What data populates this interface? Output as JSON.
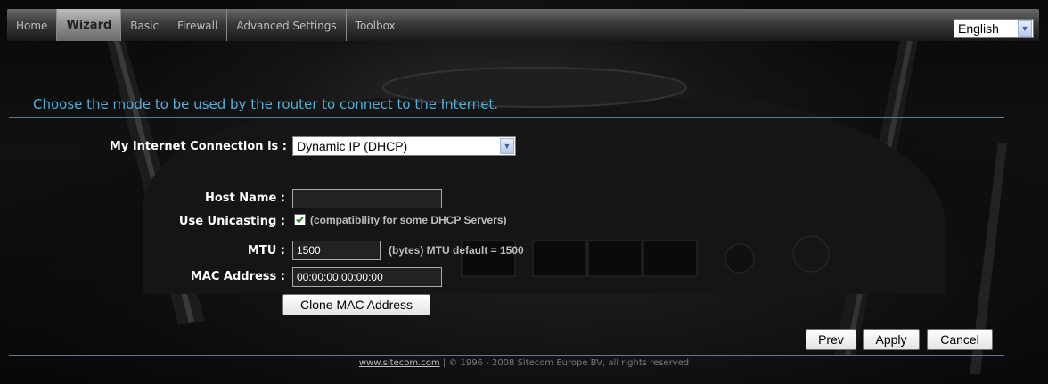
{
  "nav": {
    "tabs": [
      "Home",
      "Wizard",
      "Basic",
      "Firewall",
      "Advanced Settings",
      "Toolbox"
    ],
    "active_tab": "Wizard",
    "language": "English"
  },
  "wizard": {
    "heading": "Choose the mode to be used by the router to connect to the Internet.",
    "connection_label": "My Internet Connection is :",
    "connection_value": "Dynamic IP (DHCP)",
    "host_name_label": "Host Name :",
    "host_name_value": "",
    "unicasting_label": "Use Unicasting :",
    "unicasting_checked": true,
    "unicasting_note": "(compatibility for some DHCP Servers)",
    "mtu_label": "MTU :",
    "mtu_value": "1500",
    "mtu_note": "(bytes) MTU default = 1500",
    "mac_label": "MAC Address :",
    "mac_value": "00:00:00:00:00:00",
    "clone_button": "Clone MAC Address"
  },
  "actions": {
    "prev": "Prev",
    "apply": "Apply",
    "cancel": "Cancel"
  },
  "footer": {
    "link": "www.sitecom.com",
    "text": " | © 1996 - 2008 Sitecom Europe BV, all rights reserved"
  },
  "colors": {
    "heading": "#4fb0de",
    "background": "#0b0b0b"
  }
}
